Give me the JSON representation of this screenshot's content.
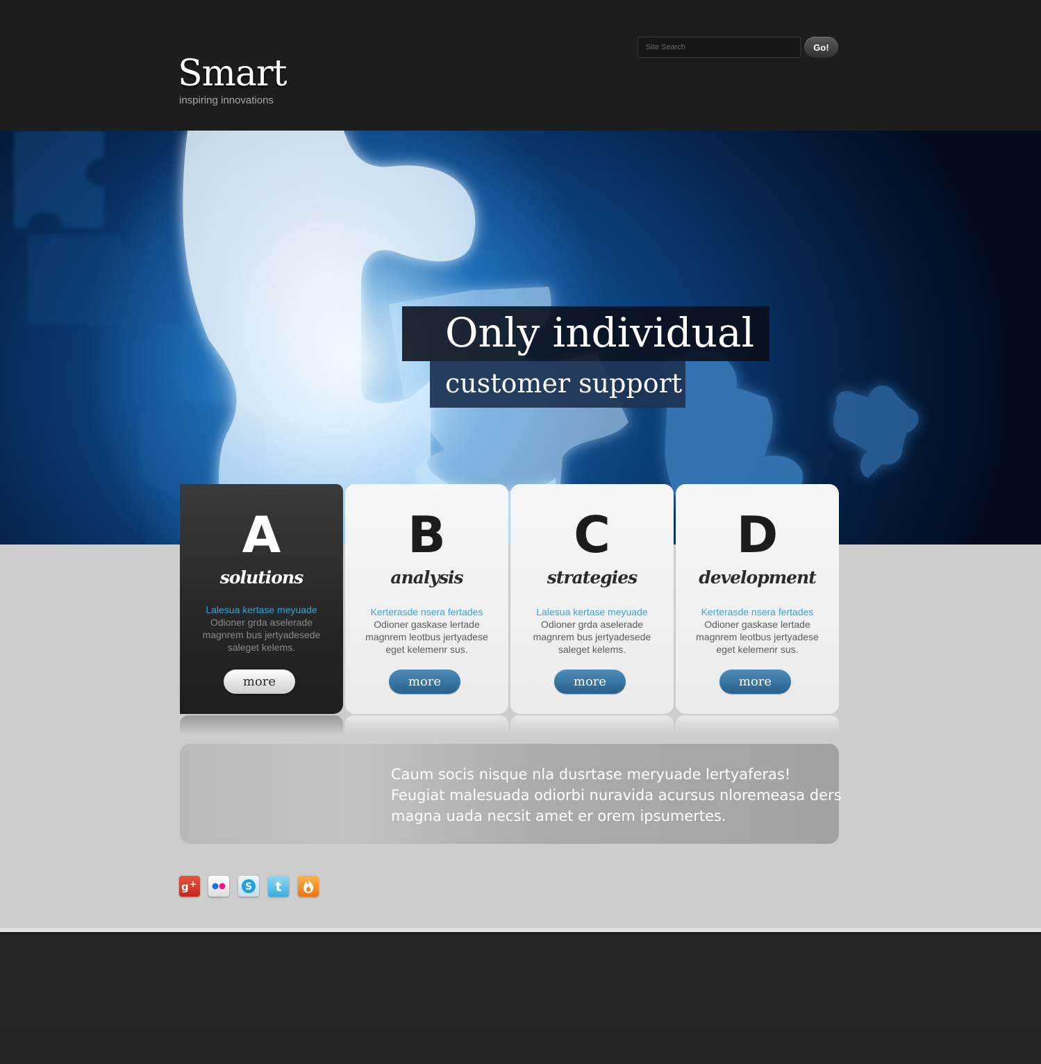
{
  "header": {
    "logo_title": "Smart",
    "logo_tagline": "inspiring innovations",
    "search_placeholder": "Site Search",
    "search_button": "Go!"
  },
  "hero": {
    "headline_line1": "Only individual",
    "headline_line2": "customer support"
  },
  "cards": [
    {
      "letter": "A",
      "title": "solutions",
      "link": "Lalesua kertase meyuade",
      "text": "Odioner grda aselerade magnrem bus jertyadesede saleget kelems.",
      "button": "more"
    },
    {
      "letter": "B",
      "title": "analysis",
      "link": "Kerterasde nsera fertades",
      "text": "Odioner gaskase lertade magnrem leotbus jertyadese eget kelemenr sus.",
      "button": "more"
    },
    {
      "letter": "C",
      "title": "strategies",
      "link": "Lalesua kertase meyuade",
      "text": "Odioner grda aselerade magnrem bus jertyadesede saleget kelems.",
      "button": "more"
    },
    {
      "letter": "D",
      "title": "development",
      "link": "Kerterasde nsera fertades",
      "text": "Odioner gaskase lertade magnrem leotbus jertyadese eget kelemenr sus.",
      "button": "more"
    }
  ],
  "quote": {
    "line1": "Caum socis nisque nla dusrtase meryuade lertyaferas!",
    "line2": "Feugiat malesuada odiorbi nuravida acursus nloremeasa ders",
    "line3": "magna uada necsit amet er orem ipsumertes."
  },
  "social": [
    {
      "icon": "google-plus-icon",
      "color": "#d93a2b"
    },
    {
      "icon": "flickr-icon",
      "color": "#f1f1f1"
    },
    {
      "icon": "skype-icon",
      "color": "#2fa8e0"
    },
    {
      "icon": "twitter-icon",
      "color": "#3fb8e4"
    },
    {
      "icon": "fire-icon",
      "color": "#f08a1c"
    }
  ],
  "colors": {
    "header_bg": "#1d1d1d",
    "accent_link": "#38a5d9",
    "button_blue": "#2f6e9b",
    "page_bg": "#cdcdcd"
  }
}
